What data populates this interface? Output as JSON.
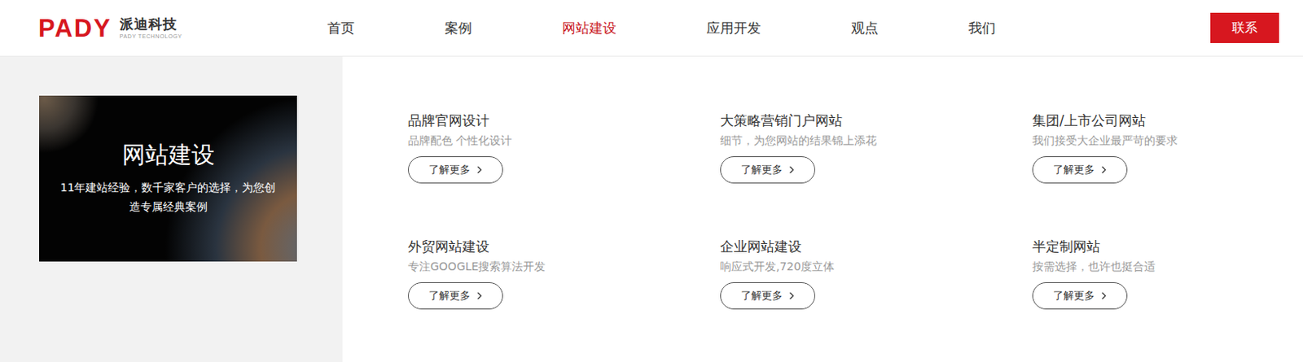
{
  "logo": {
    "mark": "PADY",
    "name": "派迪科技",
    "tagline": "PADY TECHNOLOGY"
  },
  "nav": [
    {
      "label": "首页",
      "selected": false
    },
    {
      "label": "案例",
      "selected": false
    },
    {
      "label": "网站建设",
      "selected": true
    },
    {
      "label": "应用开发",
      "selected": false
    },
    {
      "label": "观点",
      "selected": false
    },
    {
      "label": "我们",
      "selected": false
    }
  ],
  "contact_button": "联系",
  "hero": {
    "title": "网站建设",
    "subtitle": "11年建站经验，数千家客户的选择，为您创造专属经典案例"
  },
  "services": [
    {
      "title": "品牌官网设计",
      "description": "品牌配色 个性化设计",
      "button": "了解更多"
    },
    {
      "title": "大策略营销门户网站",
      "description": "细节，为您网站的结果锦上添花",
      "button": "了解更多"
    },
    {
      "title": "集团/上市公司网站",
      "description": "我们接受大企业最严苛的要求",
      "button": "了解更多"
    },
    {
      "title": "外贸网站建设",
      "description": "专注GOOGLE搜索算法开发",
      "button": "了解更多"
    },
    {
      "title": "企业网站建设",
      "description": "响应式开发,720度立体",
      "button": "了解更多"
    },
    {
      "title": "半定制网站",
      "description": "按需选择，也许也挺合适",
      "button": "了解更多"
    }
  ]
}
